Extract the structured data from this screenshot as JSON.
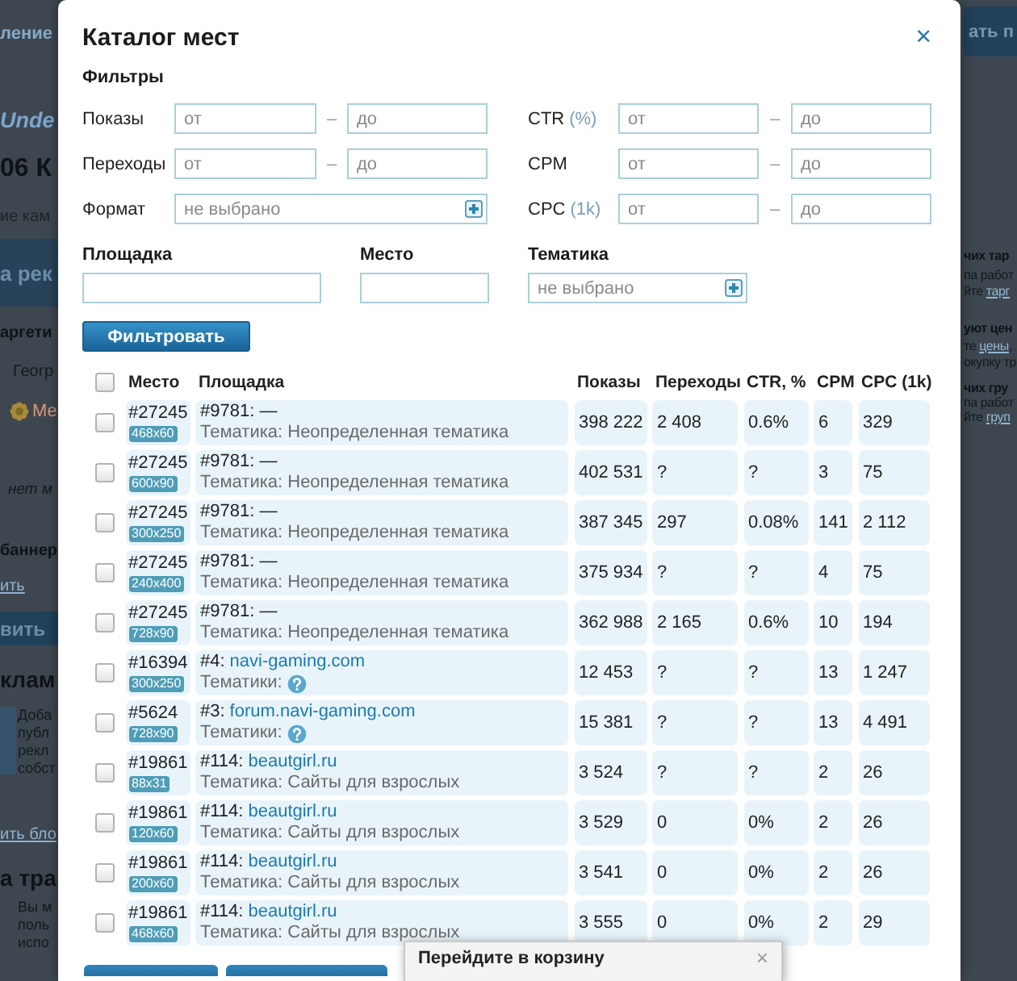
{
  "background_page": {
    "left": [
      {
        "kind": "nav",
        "text": "ление"
      },
      {
        "kind": "logo",
        "text": "Unde"
      },
      {
        "kind": "title",
        "text": "06 К"
      },
      {
        "kind": "subtext",
        "text": "ие кам"
      },
      {
        "kind": "band",
        "text": "а рек"
      },
      {
        "kind": "bold",
        "text": "аргети"
      },
      {
        "kind": "text",
        "text": "Геогр"
      },
      {
        "kind": "icon_link",
        "text": "Ме"
      },
      {
        "kind": "italic",
        "text": "нет м"
      },
      {
        "kind": "bold",
        "text": "баннер"
      },
      {
        "kind": "link",
        "text": "ить"
      },
      {
        "kind": "band_button",
        "text": "вить"
      },
      {
        "kind": "heading",
        "text": "клам"
      },
      {
        "kind": "note",
        "tile": true,
        "lines": [
          "Доба",
          "публ",
          "рекл",
          "собст"
        ]
      },
      {
        "kind": "link",
        "text": "ить бло"
      },
      {
        "kind": "heading",
        "text": "а тра"
      },
      {
        "kind": "note",
        "tile": false,
        "lines": [
          "Вы м",
          "поль",
          "испо"
        ]
      }
    ],
    "right": [
      {
        "kind": "button",
        "text": "ать п"
      },
      {
        "kind": "bold",
        "text": "чих тар"
      },
      {
        "kind": "text",
        "text": "па работ"
      },
      {
        "kind": "text",
        "text": "йте",
        "link": "тарг"
      },
      {
        "kind": "bold",
        "text": "уют цен"
      },
      {
        "kind": "text",
        "text": "те",
        "link": "цены",
        "after": ","
      },
      {
        "kind": "text",
        "text": "окупку тр"
      },
      {
        "kind": "bold",
        "text": "чих гру"
      },
      {
        "kind": "text",
        "text": "па работ"
      },
      {
        "kind": "text",
        "text": "йте",
        "link": "груп"
      }
    ]
  },
  "dialog": {
    "title": "Каталог мест",
    "close": "×",
    "filters": {
      "heading": "Фильтры",
      "rows": [
        {
          "left": {
            "kind": "range",
            "label": "Показы",
            "from": {
              "placeholder": "от"
            },
            "separator": "–",
            "to": {
              "placeholder": "до"
            }
          },
          "right": {
            "kind": "range",
            "label": "CTR",
            "unit": "(%)",
            "from": {
              "placeholder": "от"
            },
            "separator": "–",
            "to": {
              "placeholder": "до"
            }
          }
        },
        {
          "left": {
            "kind": "range",
            "label": "Переходы",
            "from": {
              "placeholder": "от"
            },
            "separator": "–",
            "to": {
              "placeholder": "до"
            }
          },
          "right": {
            "kind": "range",
            "label": "CPM",
            "from": {
              "placeholder": "от"
            },
            "separator": "–",
            "to": {
              "placeholder": "до"
            }
          }
        },
        {
          "left": {
            "kind": "select",
            "label": "Формат",
            "placeholder": "не выбрано"
          },
          "right": {
            "kind": "range",
            "label": "CPC",
            "unit": "(1k)",
            "from": {
              "placeholder": "от"
            },
            "separator": "–",
            "to": {
              "placeholder": "до"
            }
          }
        }
      ]
    },
    "search": [
      {
        "kind": "text",
        "label": "Площадка"
      },
      {
        "kind": "text",
        "label": "Место"
      },
      {
        "kind": "select",
        "label": "Тематика",
        "placeholder": "не выбрано"
      }
    ],
    "filter_button": "Фильтровать",
    "table": {
      "select_all_checked": false,
      "columns": [
        "Место",
        "Площадка",
        "Показы",
        "Переходы",
        "CTR, %",
        "CPM",
        "CPC (1k)"
      ],
      "rows": [
        {
          "checked": false,
          "place": "#27245",
          "size": "468x60",
          "site_number": "#9781:",
          "site_name": "—",
          "site_link": false,
          "topic": "Тематика: Неопределенная тематика",
          "topic_help": false,
          "shows": "398 222",
          "clicks": "2 408",
          "ctr": "0.6%",
          "cpm": "6",
          "cpc": "329"
        },
        {
          "checked": false,
          "place": "#27245",
          "size": "600x90",
          "site_number": "#9781:",
          "site_name": "—",
          "site_link": false,
          "topic": "Тематика: Неопределенная тематика",
          "topic_help": false,
          "shows": "402 531",
          "clicks": "?",
          "ctr": "?",
          "cpm": "3",
          "cpc": "75"
        },
        {
          "checked": false,
          "place": "#27245",
          "size": "300x250",
          "site_number": "#9781:",
          "site_name": "—",
          "site_link": false,
          "topic": "Тематика: Неопределенная тематика",
          "topic_help": false,
          "shows": "387 345",
          "clicks": "297",
          "ctr": "0.08%",
          "cpm": "141",
          "cpc": "2 112"
        },
        {
          "checked": false,
          "place": "#27245",
          "size": "240x400",
          "site_number": "#9781:",
          "site_name": "—",
          "site_link": false,
          "topic": "Тематика: Неопределенная тематика",
          "topic_help": false,
          "shows": "375 934",
          "clicks": "?",
          "ctr": "?",
          "cpm": "4",
          "cpc": "75"
        },
        {
          "checked": false,
          "place": "#27245",
          "size": "728x90",
          "site_number": "#9781:",
          "site_name": "—",
          "site_link": false,
          "topic": "Тематика: Неопределенная тематика",
          "topic_help": false,
          "shows": "362 988",
          "clicks": "2 165",
          "ctr": "0.6%",
          "cpm": "10",
          "cpc": "194"
        },
        {
          "checked": false,
          "place": "#16394",
          "size": "300x250",
          "site_number": "#4:",
          "site_name": "navi-gaming.com",
          "site_link": true,
          "topic": "Тематики:",
          "topic_help": true,
          "shows": "12 453",
          "clicks": "?",
          "ctr": "?",
          "cpm": "13",
          "cpc": "1 247"
        },
        {
          "checked": false,
          "place": "#5624",
          "size": "728x90",
          "site_number": "#3:",
          "site_name": "forum.navi-gaming.com",
          "site_link": true,
          "topic": "Тематики:",
          "topic_help": true,
          "shows": "15 381",
          "clicks": "?",
          "ctr": "?",
          "cpm": "13",
          "cpc": "4 491"
        },
        {
          "checked": false,
          "place": "#19861",
          "size": "88x31",
          "site_number": "#114:",
          "site_name": "beautgirl.ru",
          "site_link": true,
          "topic": "Тематика: Сайты для взрослых",
          "topic_help": false,
          "shows": "3 524",
          "clicks": "?",
          "ctr": "?",
          "cpm": "2",
          "cpc": "26"
        },
        {
          "checked": false,
          "place": "#19861",
          "size": "120x60",
          "site_number": "#114:",
          "site_name": "beautgirl.ru",
          "site_link": true,
          "topic": "Тематика: Сайты для взрослых",
          "topic_help": false,
          "shows": "3 529",
          "clicks": "0",
          "ctr": "0%",
          "cpm": "2",
          "cpc": "26"
        },
        {
          "checked": false,
          "place": "#19861",
          "size": "200x60",
          "site_number": "#114:",
          "site_name": "beautgirl.ru",
          "site_link": true,
          "topic": "Тематика: Сайты для взрослых",
          "topic_help": false,
          "shows": "3 541",
          "clicks": "0",
          "ctr": "0%",
          "cpm": "2",
          "cpc": "26"
        },
        {
          "checked": false,
          "place": "#19861",
          "size": "468x60",
          "site_number": "#114:",
          "site_name": "beautgirl.ru",
          "site_link": true,
          "topic": "Тематика: Сайты для взрослых",
          "topic_help": false,
          "shows": "3 555",
          "clicks": "0",
          "ctr": "0%",
          "cpm": "2",
          "cpc": "29"
        }
      ]
    }
  },
  "popup": {
    "title": "Перейдите в корзину",
    "close": "×"
  }
}
